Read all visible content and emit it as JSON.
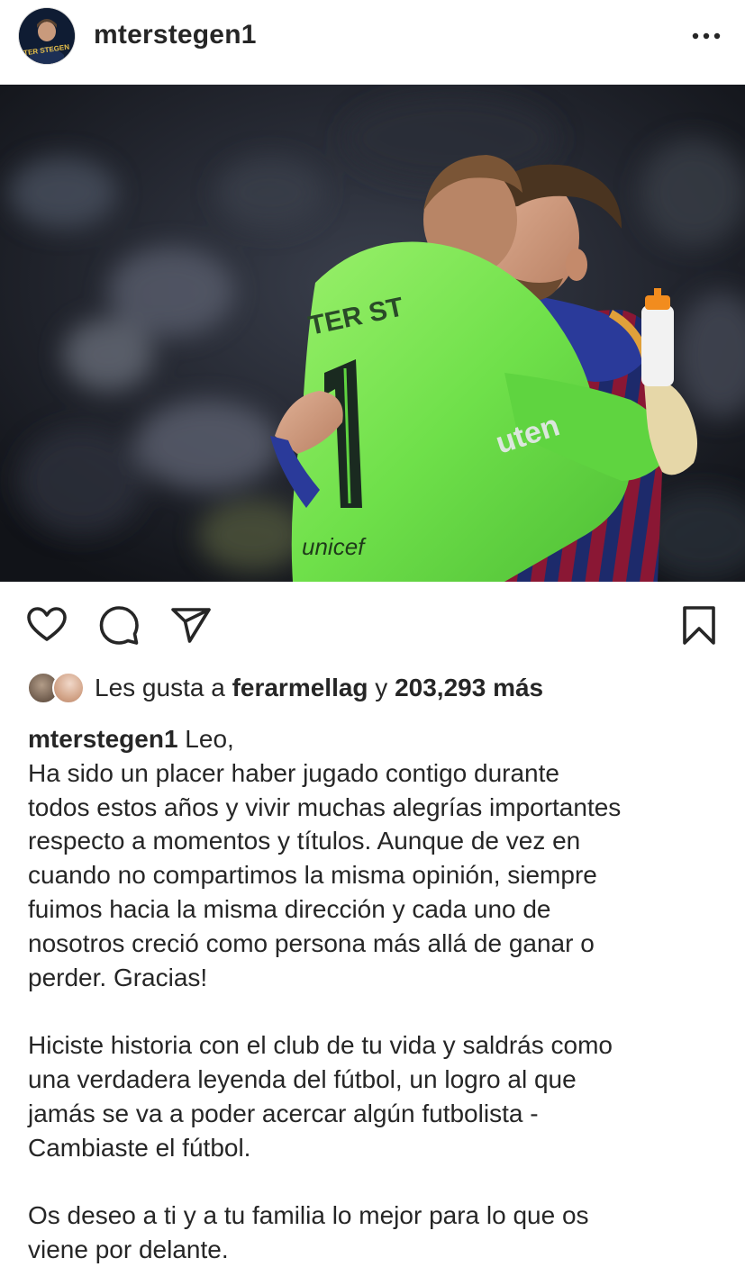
{
  "header": {
    "username": "mterstegen1",
    "avatar_text": "TER STEGEN",
    "more_icon": "more-horizontal-icon"
  },
  "photo": {
    "jersey_text": "TER ST",
    "sponsor_text": "unicef",
    "jersey_number": "1"
  },
  "actions": {
    "like_icon": "heart-icon",
    "comment_icon": "comment-bubble-icon",
    "share_icon": "paper-plane-icon",
    "save_icon": "bookmark-icon"
  },
  "likes": {
    "prefix": "Les gusta a ",
    "user": "ferarmellag",
    "joiner": " y ",
    "count": "203,293 más"
  },
  "caption": {
    "username": "mterstegen1",
    "lines": [
      "Leo,",
      "Ha sido un placer haber jugado contigo durante",
      "todos estos años y vivir muchas alegrías importantes",
      "respecto a momentos y títulos. Aunque de vez en",
      "cuando no compartimos la misma opinión, siempre",
      "fuimos hacia la misma dirección y cada uno de",
      "nosotros creció como persona más allá de ganar o",
      "perder. Gracias!",
      "",
      "Hiciste historia con el club de tu vida y saldrás como",
      "una verdadera leyenda del fútbol, un logro al que",
      "jamás se va a poder acercar algún futbolista -",
      "Cambiaste el fútbol.",
      "",
      "Os deseo a ti y a tu familia lo mejor para lo que os",
      "viene por delante."
    ]
  }
}
